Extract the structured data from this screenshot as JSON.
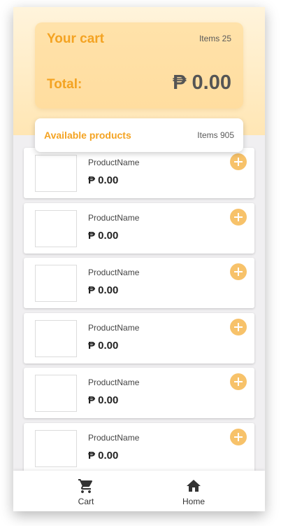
{
  "cart": {
    "title": "Your cart",
    "count": "Items 25",
    "total_label": "Total:",
    "total_value": "₱ 0.00"
  },
  "available": {
    "title": "Available products",
    "count": "Items 905"
  },
  "products": [
    {
      "name": "ProductName",
      "price": "₱ 0.00"
    },
    {
      "name": "ProductName",
      "price": "₱ 0.00"
    },
    {
      "name": "ProductName",
      "price": "₱ 0.00"
    },
    {
      "name": "ProductName",
      "price": "₱ 0.00"
    },
    {
      "name": "ProductName",
      "price": "₱ 0.00"
    },
    {
      "name": "ProductName",
      "price": "₱ 0.00"
    }
  ],
  "nav": {
    "cart_label": "Cart",
    "home_label": "Home",
    "cart_icon": "cart-icon",
    "home_icon": "home-icon"
  },
  "colors": {
    "accent": "#f4a322",
    "add_button": "#f7c26a",
    "hero_bg": "#ffe6b4"
  }
}
